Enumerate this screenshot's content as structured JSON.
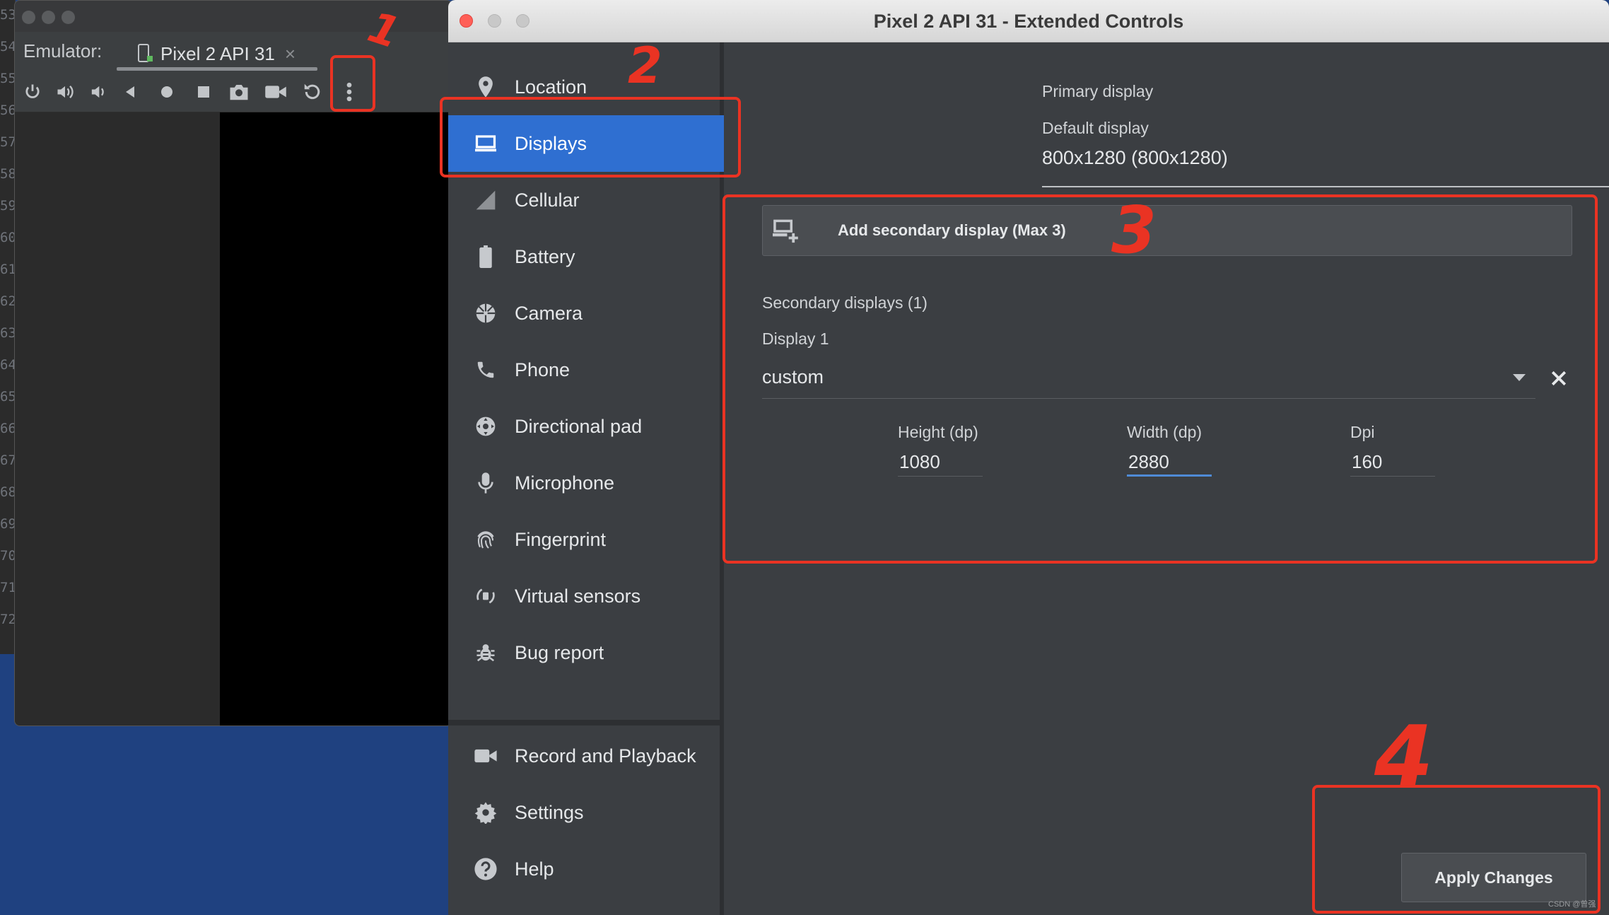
{
  "ide": {
    "line_numbers": [
      "53",
      "54",
      "55",
      "56",
      "57",
      "58",
      "59",
      "60",
      "61",
      "62",
      "63",
      "64",
      "65",
      "66",
      "67",
      "68",
      "69",
      "70",
      "71",
      "72"
    ]
  },
  "emulator": {
    "label": "Emulator:",
    "tab_label": "Pixel 2 API 31",
    "tab_close": "×",
    "toolbar_icons": [
      "power-icon",
      "volume-up-icon",
      "volume-down-icon",
      "back-icon",
      "home-icon",
      "overview-icon",
      "screenshot-icon",
      "record-icon",
      "rotate-icon",
      "more-icon"
    ]
  },
  "window": {
    "title": "Pixel 2 API 31 - Extended Controls"
  },
  "nav": {
    "items": [
      {
        "label": "Location",
        "icon": "location-pin-icon"
      },
      {
        "label": "Displays",
        "icon": "display-icon",
        "selected": true
      },
      {
        "label": "Cellular",
        "icon": "cellular-icon"
      },
      {
        "label": "Battery",
        "icon": "battery-icon"
      },
      {
        "label": "Camera",
        "icon": "camera-icon"
      },
      {
        "label": "Phone",
        "icon": "phone-icon"
      },
      {
        "label": "Directional pad",
        "icon": "dpad-icon"
      },
      {
        "label": "Microphone",
        "icon": "microphone-icon"
      },
      {
        "label": "Fingerprint",
        "icon": "fingerprint-icon"
      },
      {
        "label": "Virtual sensors",
        "icon": "virtual-sensors-icon"
      },
      {
        "label": "Bug report",
        "icon": "bug-icon"
      },
      {
        "label": "Record and Playback",
        "icon": "video-camera-icon"
      },
      {
        "label": "Settings",
        "icon": "gear-icon"
      },
      {
        "label": "Help",
        "icon": "help-icon"
      }
    ]
  },
  "displays": {
    "primary_heading": "Primary display",
    "default_label": "Default display",
    "default_value": "800x1280 (800x1280)",
    "add_button": "Add secondary display (Max 3)",
    "secondary_heading": "Secondary displays (1)",
    "display1_label": "Display 1",
    "display1_preset": "custom",
    "fields": [
      {
        "label": "Height (dp)",
        "value": "1080"
      },
      {
        "label": "Width (dp)",
        "value": "2880",
        "focused": true
      },
      {
        "label": "Dpi",
        "value": "160"
      }
    ]
  },
  "apply_button": "Apply Changes",
  "annotations": [
    "1",
    "2",
    "3",
    "4"
  ],
  "watermark": "CSDN @曾强",
  "colors": {
    "selected": "#2f6fd1",
    "annotation": "#ea3323",
    "background": "#3b3e42"
  }
}
